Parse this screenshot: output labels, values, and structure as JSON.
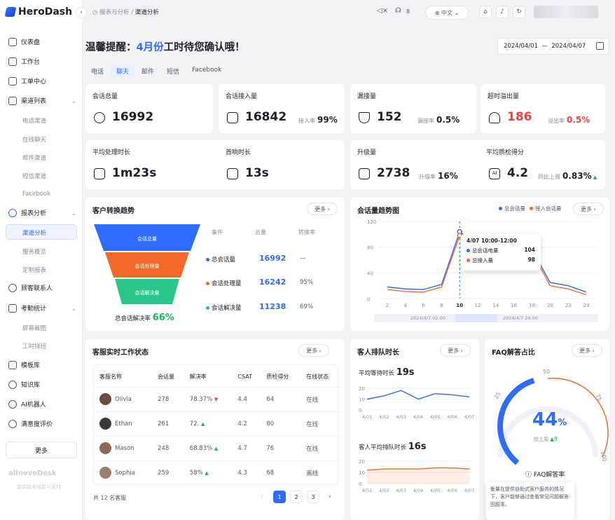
{
  "app": {
    "name": "HeroDash"
  },
  "sidebar": {
    "items": [
      {
        "label": "仪表盘",
        "icon": "home-icon"
      },
      {
        "label": "工作台",
        "icon": "workbench-icon"
      },
      {
        "label": "工单中心",
        "icon": "ticket-icon"
      },
      {
        "label": "渠道列表",
        "icon": "grid-icon"
      },
      {
        "label": "报表分析",
        "icon": "chart-icon"
      },
      {
        "label": "顾客联系人",
        "icon": "contact-icon"
      },
      {
        "label": "考勤统计",
        "icon": "calendar-icon"
      },
      {
        "label": "模板库",
        "icon": "template-icon"
      },
      {
        "label": "知识库",
        "icon": "knowledge-icon"
      },
      {
        "label": "AI机器人",
        "icon": "robot-icon"
      },
      {
        "label": "满意度评价",
        "icon": "rating-icon"
      }
    ],
    "channel_sub": [
      "电话渠道",
      "在线聊天",
      "邮件渠道",
      "短信渠道",
      "Facebook"
    ],
    "report_sub": [
      "渠道分析",
      "服务概览",
      "定制报表"
    ],
    "attendance_sub": [
      "屏幕截图",
      "工时排班"
    ],
    "more_label": "更多",
    "footer_brand": "allnovoDesk",
    "footer_text": "提供技术赋能与支持"
  },
  "header": {
    "breadcrumb_parent": "报表与分析 /",
    "breadcrumb_current": "渠道分析",
    "badge_count": "8",
    "language": "中文"
  },
  "main": {
    "reminder_pre": "温馨提醒：",
    "reminder_month": "4月份",
    "reminder_post": "工时待您确认哦！",
    "date_start": "2024/04/01",
    "date_sep": "—",
    "date_end": "2024/04/07",
    "tabs": [
      "电话",
      "聊天",
      "邮件",
      "短信",
      "Facebook"
    ]
  },
  "stats": {
    "total_sessions": {
      "label": "会话总量",
      "value": "16992"
    },
    "incoming": {
      "label": "会话接入量",
      "value": "16842",
      "sub_label": "接入率",
      "sub_value": "99%"
    },
    "missed": {
      "label": "漏接量",
      "value": "152",
      "sub_label": "漏接率",
      "sub_value": "0.5%"
    },
    "overflow": {
      "label": "超时溢出量",
      "value": "186",
      "sub_label": "溢出率",
      "sub_value": "0.5%"
    },
    "avg_handle": {
      "label": "平均处理时长",
      "value": "1m23s"
    },
    "first_response": {
      "label": "首响时长",
      "value": "13s"
    },
    "upgrade": {
      "label": "升级量",
      "value": "2738",
      "sub_label": "升级率",
      "sub_value": "16%"
    },
    "qa_score": {
      "label": "平均质检得分",
      "value": "4.2",
      "sub_label": "同比上周",
      "sub_value": "0.83%"
    }
  },
  "funnel": {
    "title": "客户转换趋势",
    "more": "更多",
    "col_event": "事件",
    "col_total": "总量",
    "col_rate": "转换率",
    "stages": [
      {
        "label": "会话总量",
        "event": "总会话量",
        "total": "16992",
        "rate": "—",
        "color": "#2f6bff"
      },
      {
        "label": "会话处理量",
        "event": "会话处理量",
        "total": "16242",
        "rate": "95%",
        "color": "#f5682a"
      },
      {
        "label": "会话解决量",
        "event": "会话解决量",
        "total": "11238",
        "rate": "69%",
        "color": "#2bc68a"
      }
    ],
    "resolve_label": "总会话解决率",
    "resolve_value": "66%"
  },
  "trend": {
    "title": "会话量趋势图",
    "more": "更多",
    "tooltip_title": "4/07 10:00-12:00",
    "tooltip_rows": [
      {
        "label": "总会话电量",
        "value": "104"
      },
      {
        "label": "总接入量",
        "value": "98"
      }
    ],
    "range_start": "2024/4/7 02:00",
    "range_end": "2024/4/7 24:00"
  },
  "agents": {
    "title": "客服实时工作状态",
    "more": "更多",
    "headers": [
      "客服名称",
      "会话量",
      "解决率",
      "CSAT",
      "质检得分",
      "在线状态"
    ],
    "rows": [
      {
        "name": "Olivia",
        "sessions": "278",
        "rate": "78.37%",
        "trend": "▼",
        "csat": "4.4",
        "qa": "64",
        "status": "在线"
      },
      {
        "name": "Ethan",
        "sessions": "261",
        "rate": "72.",
        "trend": "▲",
        "csat": "4.2",
        "qa": "80",
        "status": "在线"
      },
      {
        "name": "Mason",
        "sessions": "248",
        "rate": "68.83%",
        "trend": "▲",
        "csat": "4.7",
        "qa": "76",
        "status": "在线"
      },
      {
        "name": "Sophia",
        "sessions": "259",
        "rate": "58%",
        "trend": "▲",
        "csat": "4.3",
        "qa": "68",
        "status": "离线"
      }
    ],
    "total": "共 12 名客服",
    "pages": [
      "1",
      "2",
      "3"
    ]
  },
  "queue": {
    "title": "客人排队时长",
    "more": "更多",
    "avg_wait_label": "平均等待时长",
    "avg_wait_value": "19s",
    "avg_queue_label": "客人平均排队时长",
    "avg_queue_value": "16s",
    "dates": [
      "4/01",
      "4/02",
      "4/03",
      "4/04",
      "4/05",
      "4/06",
      "4/07"
    ]
  },
  "faq": {
    "title": "FAQ解答占比",
    "more": "更多",
    "value": "44",
    "unit": "%",
    "compare_label": "较上周",
    "compare_value": "▲8",
    "gauge_label": "FAQ解答率",
    "desc": "衡量在提供自助式客户服务的情况下，客户能够通过查看常见问题解答回题率。"
  },
  "chart_data": [
    {
      "type": "line",
      "title": "会话量趋势图",
      "x": [
        2,
        4,
        6,
        8,
        10,
        12,
        14,
        16,
        18,
        20,
        22,
        24
      ],
      "ylim": [
        0,
        120
      ],
      "yticks": [
        0,
        40,
        80,
        120
      ],
      "series": [
        {
          "name": "总会话量",
          "color": "#2f6bff",
          "values": [
            18,
            15,
            14,
            22,
            104,
            82,
            84,
            80,
            76,
            25,
            20,
            10
          ]
        },
        {
          "name": "接入会话量",
          "color": "#f5682a",
          "values": [
            14,
            11,
            10,
            18,
            98,
            78,
            80,
            76,
            72,
            20,
            15,
            6
          ]
        }
      ]
    },
    {
      "type": "line",
      "title": "平均等待时长",
      "x": [
        "4/01",
        "4/02",
        "4/03",
        "4/04",
        "4/05",
        "4/06",
        "4/07"
      ],
      "ylim": [
        0,
        20
      ],
      "yticks": [
        0,
        10,
        20
      ],
      "series": [
        {
          "name": "平均等待时长",
          "color": "#2f6bff",
          "values": [
            10,
            13,
            18,
            10,
            15,
            14,
            12
          ]
        }
      ]
    },
    {
      "type": "area",
      "title": "客人平均排队时长",
      "x": [
        "4/01",
        "4/02",
        "4/03",
        "4/04",
        "4/05",
        "4/06",
        "4/07"
      ],
      "ylim": [
        0,
        20
      ],
      "yticks": [
        0,
        10,
        20
      ],
      "series": [
        {
          "name": "客人平均排队时长",
          "color": "#f5682a",
          "values": [
            12,
            13,
            13,
            13,
            14,
            14,
            13
          ]
        }
      ]
    }
  ]
}
